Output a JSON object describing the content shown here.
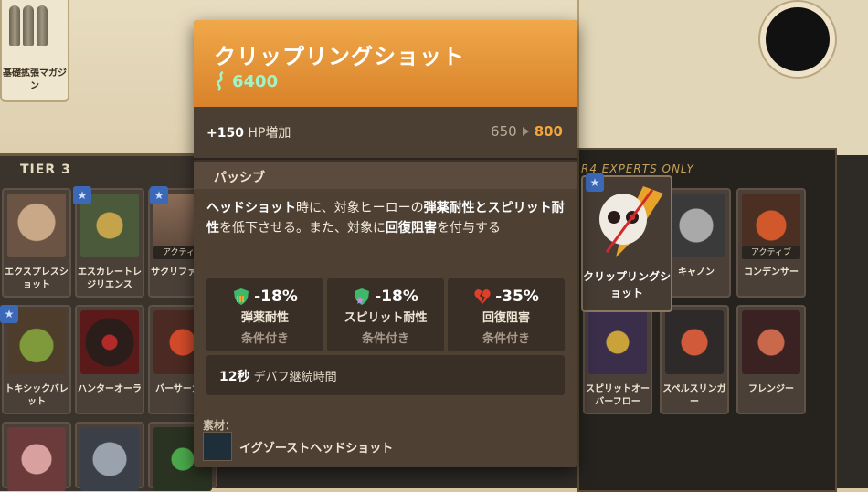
{
  "background": {
    "top_card_label": "基礎拡張マガジン",
    "tier_left_label": "TIER 3",
    "tier_right_label": "R4  EXPERTS ONLY",
    "left_cards": [
      {
        "label": "エクスプレスショット"
      },
      {
        "label": "エスカレートレジリエンス"
      },
      {
        "label": "サクリファイス",
        "tag": "アクティブ"
      },
      {
        "label": "トキシックバレット"
      },
      {
        "label": "ハンターオーラ"
      },
      {
        "label": "バーサーカー"
      }
    ],
    "right_cards": [
      {
        "label": "キャノン"
      },
      {
        "label": "コンデンサー",
        "tag": "アクティブ"
      },
      {
        "label": "スピリットオーバーフロー"
      },
      {
        "label": "スペルスリンガー"
      },
      {
        "label": "フレンジー"
      }
    ],
    "hovered_card_label": "クリップリングショット"
  },
  "tooltip": {
    "title": "クリップリングショット",
    "cost": "6400",
    "hp_bonus": "+150",
    "hp_label": "HP増加",
    "hp_old": "650",
    "hp_new": "800",
    "passive_label": "パッシブ",
    "description": {
      "p1": "ヘッドショット",
      "p2": "時に、対象ヒーローの",
      "p3": "弾薬耐性とスピリット耐性",
      "p4": "を低下させる。また、対象に",
      "p5": "回復阻害",
      "p6": "を付与する"
    },
    "stats": [
      {
        "value": "-18%",
        "name": "弾薬耐性",
        "condition": "条件付き",
        "icon": "bullet-shield-icon"
      },
      {
        "value": "-18%",
        "name": "スピリット耐性",
        "condition": "条件付き",
        "icon": "spirit-shield-icon"
      },
      {
        "value": "-35%",
        "name": "回復阻害",
        "condition": "条件付き",
        "icon": "broken-heart-icon"
      }
    ],
    "duration_value": "12秒",
    "duration_label": "デバフ継続時間",
    "materials_label": "素材：",
    "material_name": "イグゾーストヘッドショット"
  },
  "colors": {
    "header_orange": "#e89a3c",
    "cost_green": "#9ff5c8",
    "hp_new_orange": "#f4a63a"
  }
}
